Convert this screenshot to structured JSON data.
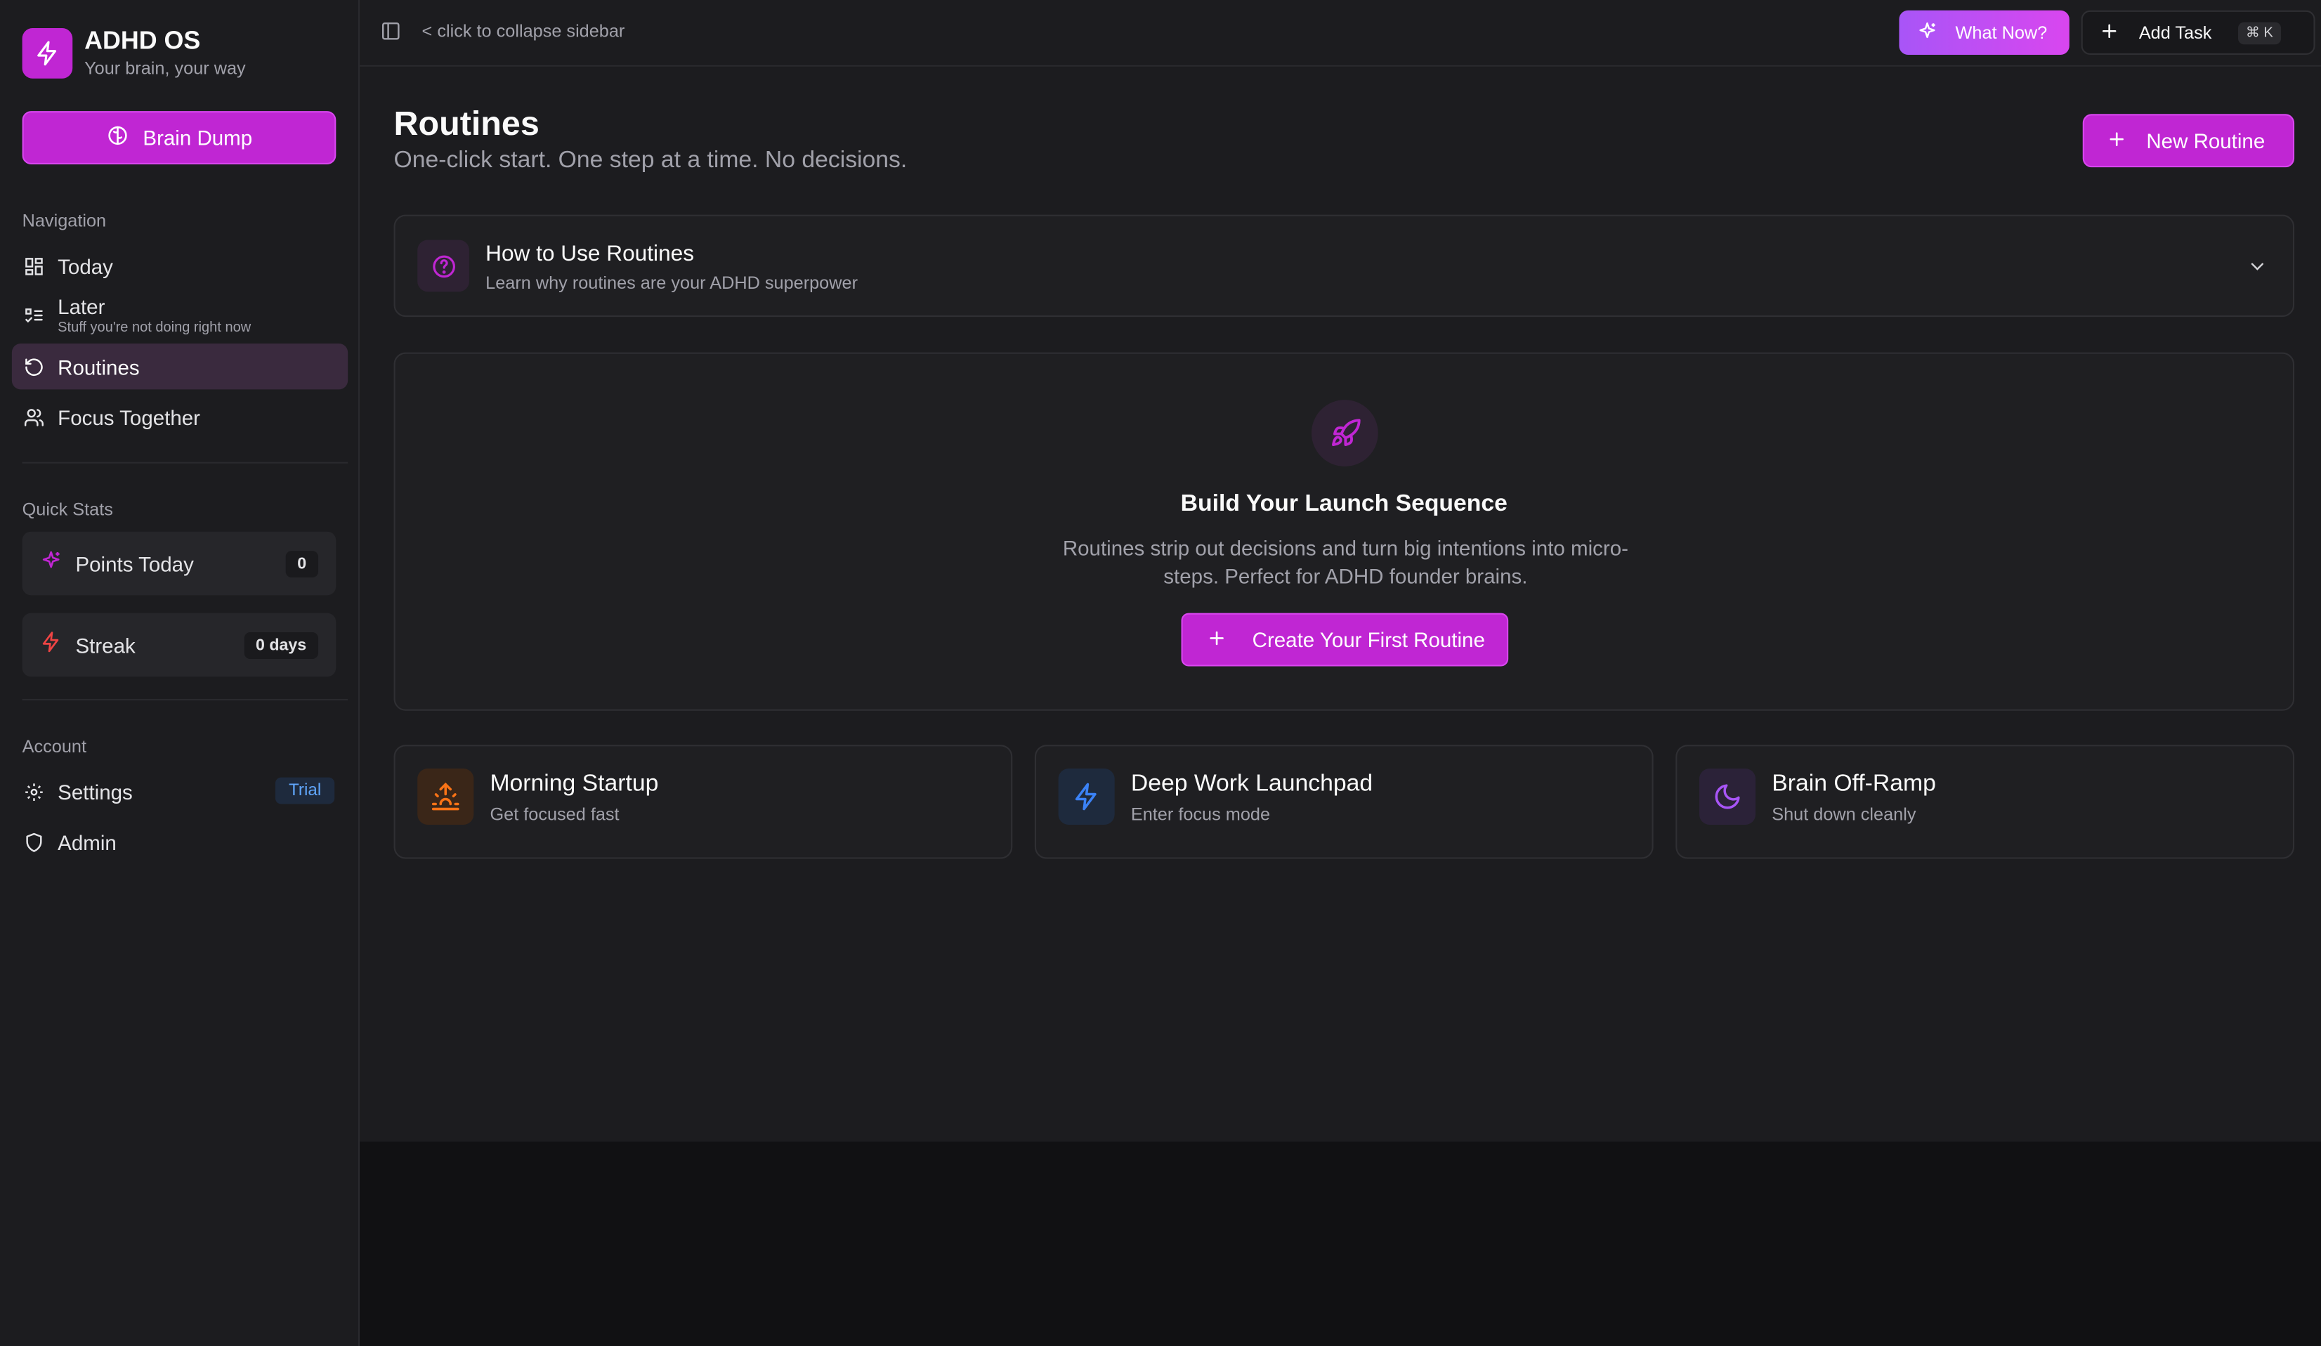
{
  "brand": {
    "title": "ADHD OS",
    "subtitle": "Your brain, your way"
  },
  "sidebar": {
    "brain_dump": "Brain Dump",
    "nav_label": "Navigation",
    "nav": {
      "today": "Today",
      "later": "Later",
      "later_sub": "Stuff you're not doing right now",
      "routines": "Routines",
      "focus": "Focus Together"
    },
    "stats_label": "Quick Stats",
    "stats": {
      "points_label": "Points Today",
      "points_value": "0",
      "streak_label": "Streak",
      "streak_value": "0 days"
    },
    "account_label": "Account",
    "account": {
      "settings": "Settings",
      "trial": "Trial",
      "admin": "Admin"
    }
  },
  "topbar": {
    "collapse_hint": "< click to collapse sidebar",
    "what_now": "What Now?",
    "add_task": "Add Task",
    "shortcut": "⌘ K"
  },
  "page": {
    "title": "Routines",
    "subtitle": "One-click start. One step at a time. No decisions.",
    "new_routine": "New Routine"
  },
  "howto": {
    "title": "How to Use Routines",
    "subtitle": "Learn why routines are your ADHD superpower"
  },
  "launch": {
    "title": "Build Your Launch Sequence",
    "description": "Routines strip out decisions and turn big intentions into micro-steps. Perfect for ADHD founder brains.",
    "button": "Create Your First Routine"
  },
  "templates": [
    {
      "title": "Morning Startup",
      "subtitle": "Get focused fast",
      "icon": "sunrise-icon",
      "color": "#f97316"
    },
    {
      "title": "Deep Work Launchpad",
      "subtitle": "Enter focus mode",
      "icon": "zap-icon",
      "color": "#3b82f6"
    },
    {
      "title": "Brain Off-Ramp",
      "subtitle": "Shut down cleanly",
      "icon": "moon-icon",
      "color": "#a855f7"
    }
  ],
  "colors": {
    "accent": "#c026d3",
    "background": "#1c1c1f",
    "trial": "#60a5fa"
  }
}
